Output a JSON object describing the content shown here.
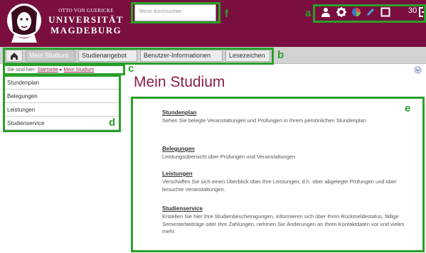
{
  "header": {
    "logo_line1": "OTTO VON GUERICKE",
    "logo_line2": "UNIVERSITÄT",
    "logo_line3": "MAGDEBURG",
    "search_placeholder": "Menü durchsuchen",
    "counter": "30",
    "icons": [
      "user-icon",
      "gear-icon",
      "color-palette-icon",
      "pencil-icon",
      "square-icon",
      "logout-icon"
    ]
  },
  "nav": {
    "tabs": [
      "Mein Studium",
      "Studienangebot",
      "Benutzer-Informationen",
      "Lesezeichen"
    ],
    "active_tab": "Mein Studium"
  },
  "breadcrumb": {
    "prefix": "Sie sind hier:",
    "start": "Startseite",
    "separator": "▸",
    "current": "Mein Studium"
  },
  "sidebar": {
    "items": [
      "Stundenplan",
      "Belegungen",
      "Leistungen",
      "Studienservice"
    ]
  },
  "main": {
    "title": "Mein Studium",
    "entries": [
      {
        "title": "Stundenplan",
        "desc": "Sehen Sie belegte Veranstaltungen und Prüfungen in Ihrem persönlichen Stundenplan"
      },
      {
        "title": "Belegungen",
        "desc": "Leistungsübersicht über Prüfungen und Veranstaltungen"
      },
      {
        "title": "Leistungen",
        "desc": "Verschaffen Sie sich einen Überblick über Ihre Leistungen, d.h. über abgelegte Prüfungen und über besuchte Veranstaltungen."
      },
      {
        "title": "Studienservice",
        "desc": "Erstellen Sie hier Ihre Studienbescheinigungen, informieren sich über Ihren Rückmeldestatus, fällige Semesterbeiträge oder Ihre Zahlungen, nehmen Sie Änderungen an Ihren Kontaktdaten vor und vieles mehr."
      }
    ]
  },
  "annotations": [
    "a",
    "b",
    "c",
    "d",
    "e",
    "f"
  ],
  "colors": {
    "header_bg": "#7a0f3f",
    "title": "#8b1e4c",
    "highlight": "#2aa02a",
    "nav_bg": "#d2d2d2"
  }
}
